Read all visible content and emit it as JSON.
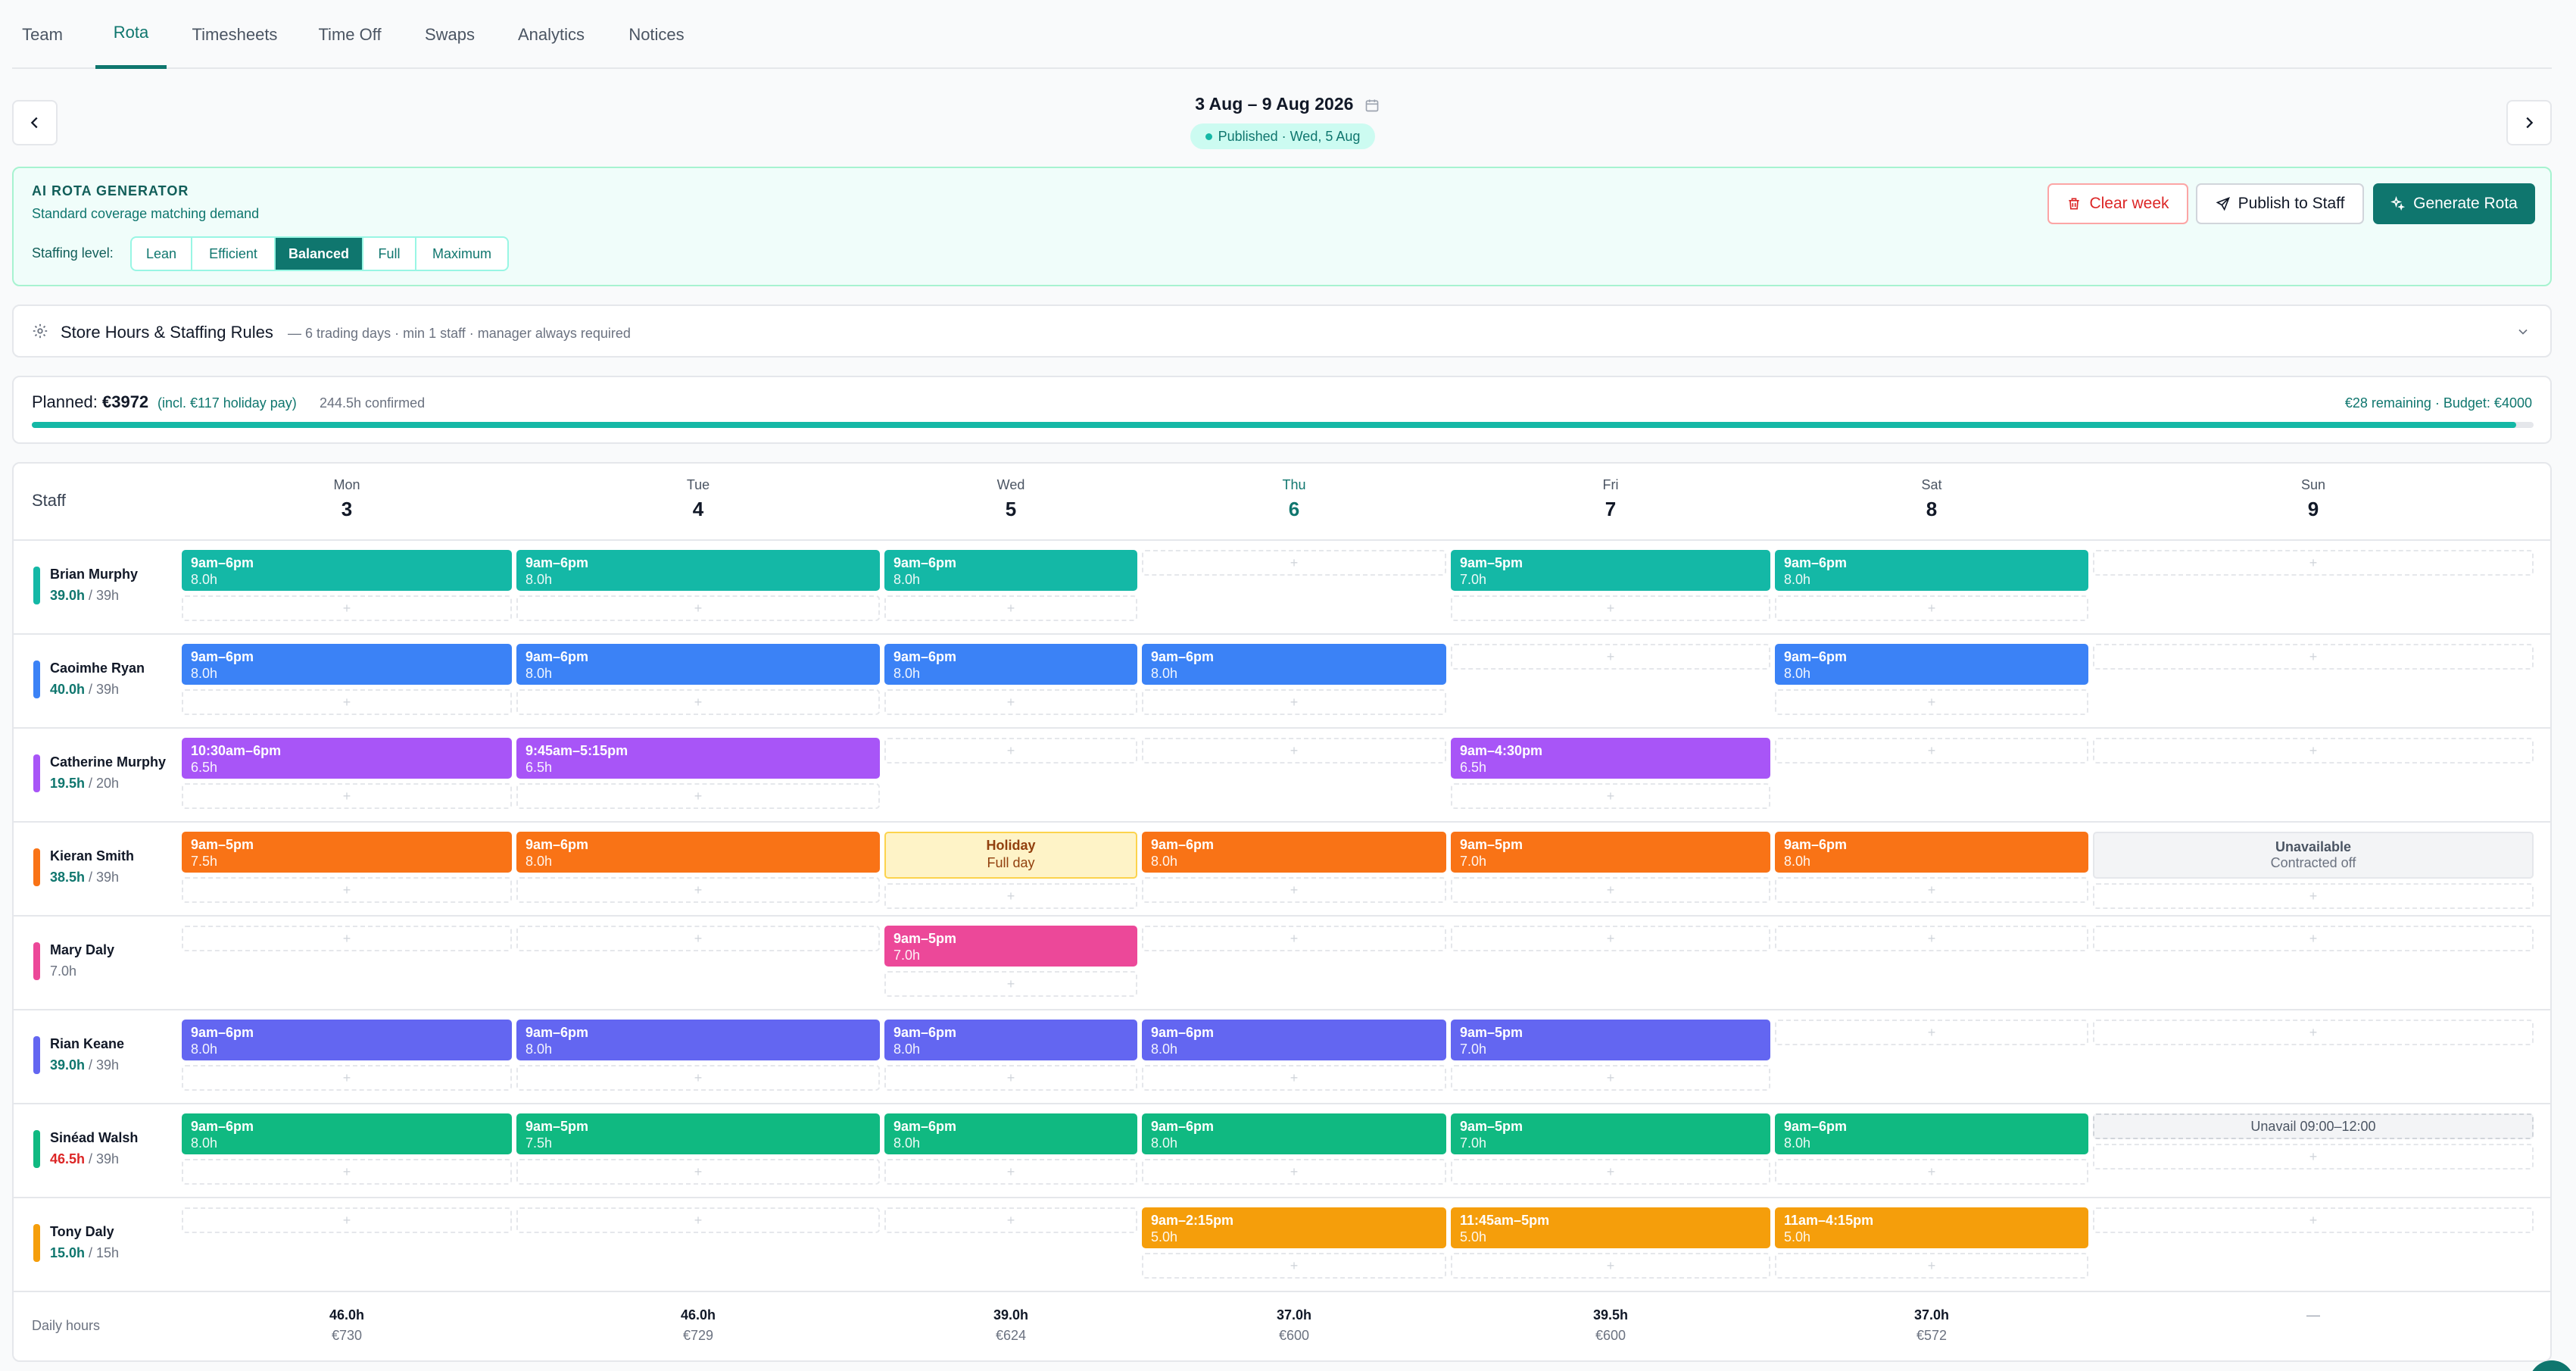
{
  "tabs": [
    {
      "label": "Team",
      "active": false
    },
    {
      "label": "Rota",
      "active": true
    },
    {
      "label": "Timesheets",
      "active": false
    },
    {
      "label": "Time Off",
      "active": false
    },
    {
      "label": "Swaps",
      "active": false
    },
    {
      "label": "Analytics",
      "active": false
    },
    {
      "label": "Notices",
      "active": false
    }
  ],
  "week": {
    "title": "3 Aug – 9 Aug 2026",
    "status": "Published · Wed, 5 Aug"
  },
  "icons": {
    "prev": "chevron-left-icon",
    "next": "chevron-right-icon",
    "calendar": "calendar-icon",
    "trash": "trash-icon",
    "send": "send-icon",
    "sparkle": "sparkle-icon",
    "gear": "gear-icon",
    "expand": "chevron-down-icon"
  },
  "ai": {
    "title": "AI ROTA GENERATOR",
    "subtitle": "Standard coverage matching demand",
    "staffing_label": "Staffing level:",
    "levels": [
      "Lean",
      "Efficient",
      "Balanced",
      "Full",
      "Maximum"
    ],
    "selected_level": "Balanced",
    "clear_label": "Clear week",
    "publish_label": "Publish to Staff",
    "generate_label": "Generate Rota"
  },
  "rules": {
    "title": "Store Hours & Staffing Rules",
    "meta": "— 6 trading days · min 1 staff · manager always required"
  },
  "budget": {
    "planned_label": "Planned:",
    "planned_value": "€3972",
    "holiday_pay": "(incl. €117 holiday pay)",
    "confirmed": "244.5h confirmed",
    "remaining": "€28 remaining · Budget: €4000",
    "used_fraction": 0.993
  },
  "grid": {
    "staff_header": "Staff",
    "days": [
      {
        "name": "Mon",
        "num": "3",
        "today": false
      },
      {
        "name": "Tue",
        "num": "4",
        "today": false
      },
      {
        "name": "Wed",
        "num": "5",
        "today": false
      },
      {
        "name": "Thu",
        "num": "6",
        "today": true
      },
      {
        "name": "Fri",
        "num": "7",
        "today": false
      },
      {
        "name": "Sat",
        "num": "8",
        "today": false
      },
      {
        "name": "Sun",
        "num": "9",
        "today": false
      }
    ],
    "add_glyph": "+",
    "staff": [
      {
        "name": "Brian Murphy",
        "hours": "39.0h",
        "contract": " / 39h",
        "hours_state": "ok",
        "color": "#14b8a6",
        "cells": [
          {
            "type": "shift",
            "time": "9am–6pm",
            "hours": "8.0h"
          },
          {
            "type": "shift",
            "time": "9am–6pm",
            "hours": "8.0h"
          },
          {
            "type": "shift",
            "time": "9am–6pm",
            "hours": "8.0h"
          },
          {
            "type": "empty"
          },
          {
            "type": "shift",
            "time": "9am–5pm",
            "hours": "7.0h"
          },
          {
            "type": "shift",
            "time": "9am–6pm",
            "hours": "8.0h"
          },
          {
            "type": "empty"
          }
        ]
      },
      {
        "name": "Caoimhe Ryan",
        "hours": "40.0h",
        "contract": " / 39h",
        "hours_state": "ok",
        "color": "#3b82f6",
        "cells": [
          {
            "type": "shift",
            "time": "9am–6pm",
            "hours": "8.0h"
          },
          {
            "type": "shift",
            "time": "9am–6pm",
            "hours": "8.0h"
          },
          {
            "type": "shift",
            "time": "9am–6pm",
            "hours": "8.0h"
          },
          {
            "type": "shift",
            "time": "9am–6pm",
            "hours": "8.0h"
          },
          {
            "type": "empty"
          },
          {
            "type": "shift",
            "time": "9am–6pm",
            "hours": "8.0h"
          },
          {
            "type": "empty"
          }
        ]
      },
      {
        "name": "Catherine Murphy",
        "hours": "19.5h",
        "contract": " / 20h",
        "hours_state": "ok",
        "color": "#a855f7",
        "cells": [
          {
            "type": "shift",
            "time": "10:30am–6pm",
            "hours": "6.5h"
          },
          {
            "type": "shift",
            "time": "9:45am–5:15pm",
            "hours": "6.5h"
          },
          {
            "type": "empty"
          },
          {
            "type": "empty"
          },
          {
            "type": "shift",
            "time": "9am–4:30pm",
            "hours": "6.5h"
          },
          {
            "type": "empty"
          },
          {
            "type": "empty"
          }
        ]
      },
      {
        "name": "Kieran Smith",
        "hours": "38.5h",
        "contract": " / 39h",
        "hours_state": "ok",
        "color": "#f97316",
        "cells": [
          {
            "type": "shift",
            "time": "9am–5pm",
            "hours": "7.5h"
          },
          {
            "type": "shift",
            "time": "9am–6pm",
            "hours": "8.0h"
          },
          {
            "type": "holiday",
            "title": "Holiday",
            "sub": "Full day"
          },
          {
            "type": "shift",
            "time": "9am–6pm",
            "hours": "8.0h"
          },
          {
            "type": "shift",
            "time": "9am–5pm",
            "hours": "7.0h"
          },
          {
            "type": "shift",
            "time": "9am–6pm",
            "hours": "8.0h"
          },
          {
            "type": "unavailable",
            "title": "Unavailable",
            "sub": "Contracted off"
          }
        ]
      },
      {
        "name": "Mary Daly",
        "hours": "7.0h",
        "contract": "",
        "hours_state": "plain",
        "color": "#ec4899",
        "cells": [
          {
            "type": "empty"
          },
          {
            "type": "empty"
          },
          {
            "type": "shift",
            "time": "9am–5pm",
            "hours": "7.0h"
          },
          {
            "type": "empty"
          },
          {
            "type": "empty"
          },
          {
            "type": "empty"
          },
          {
            "type": "empty"
          }
        ]
      },
      {
        "name": "Rian Keane",
        "hours": "39.0h",
        "contract": " / 39h",
        "hours_state": "ok",
        "color": "#6366f1",
        "cells": [
          {
            "type": "shift",
            "time": "9am–6pm",
            "hours": "8.0h"
          },
          {
            "type": "shift",
            "time": "9am–6pm",
            "hours": "8.0h"
          },
          {
            "type": "shift",
            "time": "9am–6pm",
            "hours": "8.0h"
          },
          {
            "type": "shift",
            "time": "9am–6pm",
            "hours": "8.0h"
          },
          {
            "type": "shift",
            "time": "9am–5pm",
            "hours": "7.0h"
          },
          {
            "type": "empty"
          },
          {
            "type": "empty"
          }
        ]
      },
      {
        "name": "Sinéad Walsh",
        "hours": "46.5h",
        "contract": " / 39h",
        "hours_state": "over",
        "color": "#10b981",
        "cells": [
          {
            "type": "shift",
            "time": "9am–6pm",
            "hours": "8.0h"
          },
          {
            "type": "shift",
            "time": "9am–5pm",
            "hours": "7.5h"
          },
          {
            "type": "shift",
            "time": "9am–6pm",
            "hours": "8.0h"
          },
          {
            "type": "shift",
            "time": "9am–6pm",
            "hours": "8.0h"
          },
          {
            "type": "shift",
            "time": "9am–5pm",
            "hours": "7.0h"
          },
          {
            "type": "shift",
            "time": "9am–6pm",
            "hours": "8.0h"
          },
          {
            "type": "partial",
            "title": "Unavail 09:00–12:00"
          }
        ]
      },
      {
        "name": "Tony Daly",
        "hours": "15.0h",
        "contract": " / 15h",
        "hours_state": "ok",
        "color": "#f59e0b",
        "cells": [
          {
            "type": "empty"
          },
          {
            "type": "empty"
          },
          {
            "type": "empty"
          },
          {
            "type": "shift",
            "time": "9am–2:15pm",
            "hours": "5.0h"
          },
          {
            "type": "shift",
            "time": "11:45am–5pm",
            "hours": "5.0h"
          },
          {
            "type": "shift",
            "time": "11am–4:15pm",
            "hours": "5.0h"
          },
          {
            "type": "empty"
          }
        ]
      }
    ],
    "daily_label": "Daily hours",
    "daily_totals": [
      {
        "hours": "46.0h",
        "cost": "€730"
      },
      {
        "hours": "46.0h",
        "cost": "€729"
      },
      {
        "hours": "39.0h",
        "cost": "€624"
      },
      {
        "hours": "37.0h",
        "cost": "€600"
      },
      {
        "hours": "39.5h",
        "cost": "€600"
      },
      {
        "hours": "37.0h",
        "cost": "€572"
      },
      {
        "hours": "—",
        "cost": ""
      }
    ]
  }
}
